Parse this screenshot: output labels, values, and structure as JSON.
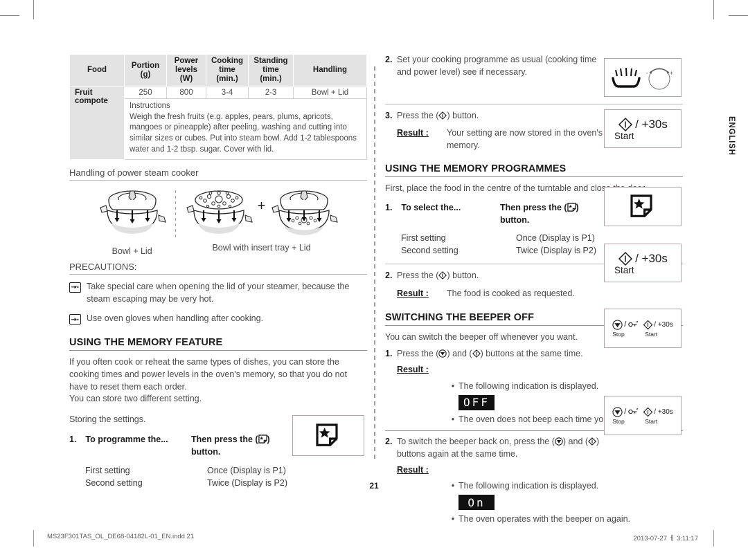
{
  "document": {
    "page_number": "21",
    "side_tab": "ENGLISH",
    "footer_left": "MS23F301TAS_OL_DE68-04182L-01_EN.indd   21",
    "footer_right": "2013-07-27   ㅔ 3:11:17"
  },
  "table": {
    "headers": [
      "Food",
      "Portion\n(g)",
      "Power\nlevels\n(W)",
      "Cooking\ntime\n(min.)",
      "Standing\ntime\n(min.)",
      "Handling"
    ],
    "header_food": "Food",
    "header_portion_l1": "Portion",
    "header_portion_l2": "(g)",
    "header_power_l1": "Power",
    "header_power_l2": "levels",
    "header_power_l3": "(W)",
    "header_cooking_l1": "Cooking",
    "header_cooking_l2": "time",
    "header_cooking_l3": "(min.)",
    "header_standing_l1": "Standing",
    "header_standing_l2": "time",
    "header_standing_l3": "(min.)",
    "header_handling": "Handling",
    "row_food_l1": "Fruit",
    "row_food_l2": "compote",
    "row_portion": "250",
    "row_power": "800",
    "row_cooking": "3-4",
    "row_standing": "2-3",
    "row_handling": "Bowl + Lid",
    "instructions_label": "Instructions",
    "instructions_text": "Weigh the fresh fruits (e.g. apples, pears, plums, apricots, mangoes or pineapple) after peeling, washing and cutting into similar sizes or cubes. Put into steam bowl. Add 1-2 tablespoons water and 1-2 tbsp. sugar. Cover with lid."
  },
  "steam": {
    "heading": "Handling of power steam cooker",
    "caption_left": "Bowl + Lid",
    "caption_right": "Bowl with insert tray + Lid",
    "plus": "+"
  },
  "precautions": {
    "heading": "PRECAUTIONS:",
    "items": [
      "Take special care when opening the lid of your steamer, because the steam escaping may be very hot.",
      "Use oven gloves when handling after cooking."
    ]
  },
  "memory_feature": {
    "heading": "USING THE MEMORY FEATURE",
    "para1": "If you often cook or reheat the same types of dishes, you can store the cooking times and power levels in the oven's memory, so that you do not have to reset them each order.",
    "para2": "You can store two different setting.",
    "para3": "Storing the settings.",
    "step1_num": "1.",
    "step1_col1": "To programme the...",
    "step1_col2_l1": "Then press the (",
    "step1_col2_l1_end": ") ",
    "step1_col2_l2": "button.",
    "rows": [
      {
        "left": "First setting",
        "right": "Once (Display is P1)"
      },
      {
        "left": "Second setting",
        "right": "Twice (Display is P2)"
      }
    ]
  },
  "right_column": {
    "step2_num": "2.",
    "step2_text": "Set your cooking programme as usual (cooking time and power level) see if necessary.",
    "step3_num": "3.",
    "step3_text_pre": "Press the (",
    "step3_text_post": ") button.",
    "step3_result_label": "Result :",
    "step3_result_text": "Your setting are now stored in the oven's memory."
  },
  "memory_programmes": {
    "heading": "USING THE MEMORY PROGRAMMES",
    "intro": "First, place the food in the centre of the turntable and close the door.",
    "step1_num": "1.",
    "step1_col1": "To select the...",
    "step1_col2_l1": "Then press the (",
    "step1_col2_l2": "button.",
    "rows": [
      {
        "left": "First setting",
        "right": "Once (Display is P1)"
      },
      {
        "left": "Second setting",
        "right": "Twice (Display is P2)"
      }
    ],
    "step2_num": "2.",
    "step2_text_pre": "Press the (",
    "step2_text_post": ") button.",
    "step2_result_label": "Result :",
    "step2_result_text": "The food is cooked as requested."
  },
  "beeper": {
    "heading": "SWITCHING THE BEEPER OFF",
    "intro": "You can switch the beeper off whenever you want.",
    "step1_num": "1.",
    "step1_text_a": "Press the (",
    "step1_text_b": ") and (",
    "step1_text_c": ") buttons at the same time.",
    "step1_result_label": "Result :",
    "step1_bullet1": "The following indication is displayed.",
    "lcd_off": "OFF",
    "step1_bullet2": "The oven does not beep each time you press a button.",
    "step2_num": "2.",
    "step2_text_a": "To switch the beeper back on, press the (",
    "step2_text_b": ") and (",
    "step2_text_c": ")",
    "step2_text_d": "buttons again at the same time.",
    "step2_result_label": "Result :",
    "step2_bullet1": "The following indication is displayed.",
    "lcd_on": "On",
    "step2_bullet2": "The oven operates with the beeper on again.",
    "bullet_glyph": "•"
  },
  "icon_boxes": {
    "start_label": "Start",
    "start_plus30": "/ +30s",
    "stop_label": "Stop",
    "stop_plus30": "/ +30s",
    "slash": "/"
  },
  "colors": {
    "header_bg": "#e3e3e3",
    "text": "#4a4a4a",
    "heading": "#1c1c1c",
    "rule": "#8e8e8e",
    "box_border": "#b3a5a5",
    "lcd_bg": "#111111"
  }
}
